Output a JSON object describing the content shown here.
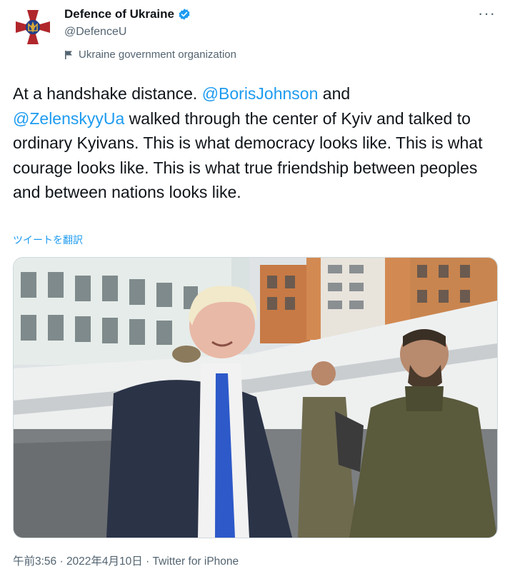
{
  "account": {
    "display_name": "Defence of Ukraine",
    "handle": "@DefenceU",
    "label": "Ukraine government organization"
  },
  "tweet": {
    "text_1": "At a handshake distance. ",
    "mention_1": "@BorisJohnson",
    "text_2": " and",
    "mention_2": "@ZelenskyyUa",
    "text_3": " walked through the center of Kyiv and talked to ordinary Kyivans. This is what democracy looks like. This is what courage looks like. This is what true friendship between peoples and between nations looks like.",
    "translate_link": "ツイートを翻訳"
  },
  "footer": {
    "meta": "午前3:56 · 2022年4月10日 · Twitter for iPhone"
  },
  "colors": {
    "link": "#1d9bf0",
    "secondary_text": "#536471",
    "verified": "#1d9bf0",
    "avatar_red": "#b0262b",
    "avatar_gold": "#d6a83a"
  },
  "icons": {
    "avatar": "defence-emblem-icon",
    "verified": "verified-badge-icon",
    "label": "flag-icon",
    "more": "more-options-icon"
  }
}
